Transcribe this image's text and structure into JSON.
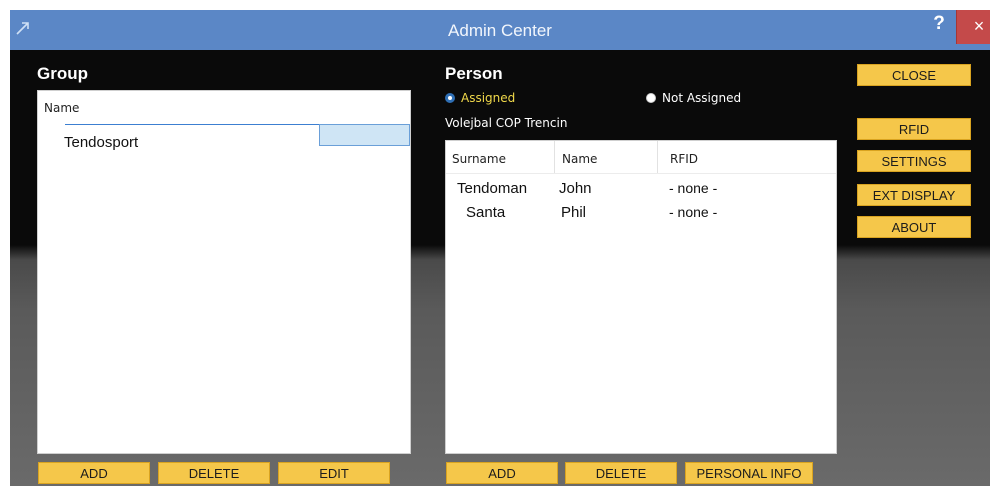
{
  "window": {
    "title": "Admin Center",
    "help_label": "?",
    "close_label": "×"
  },
  "group": {
    "title": "Group",
    "column_name": "Name",
    "items": [
      "Tendosport"
    ],
    "buttons": {
      "add": "ADD",
      "delete": "DELETE",
      "edit": "EDIT"
    }
  },
  "person": {
    "title": "Person",
    "radio_assigned": "Assigned",
    "radio_not_assigned": "Not Assigned",
    "group_label": "Volejbal COP Trencin",
    "columns": {
      "surname": "Surname",
      "name": "Name",
      "rfid": "RFID"
    },
    "rows": [
      {
        "surname": "Tendoman",
        "name": "John",
        "rfid": "- none -"
      },
      {
        "surname": "Santa",
        "name": "Phil",
        "rfid": "- none -"
      }
    ],
    "buttons": {
      "add": "ADD",
      "delete": "DELETE",
      "personal_info": "PERSONAL INFO"
    }
  },
  "side_buttons": {
    "close": "CLOSE",
    "rfid": "RFID",
    "settings": "SETTINGS",
    "ext_display": "EXT DISPLAY",
    "about": "ABOUT"
  },
  "colors": {
    "titlebar": "#5b87c6",
    "button_gold": "#f5c74a",
    "radio_selected_text": "#f0d84a",
    "close_red": "#c44a4a"
  }
}
